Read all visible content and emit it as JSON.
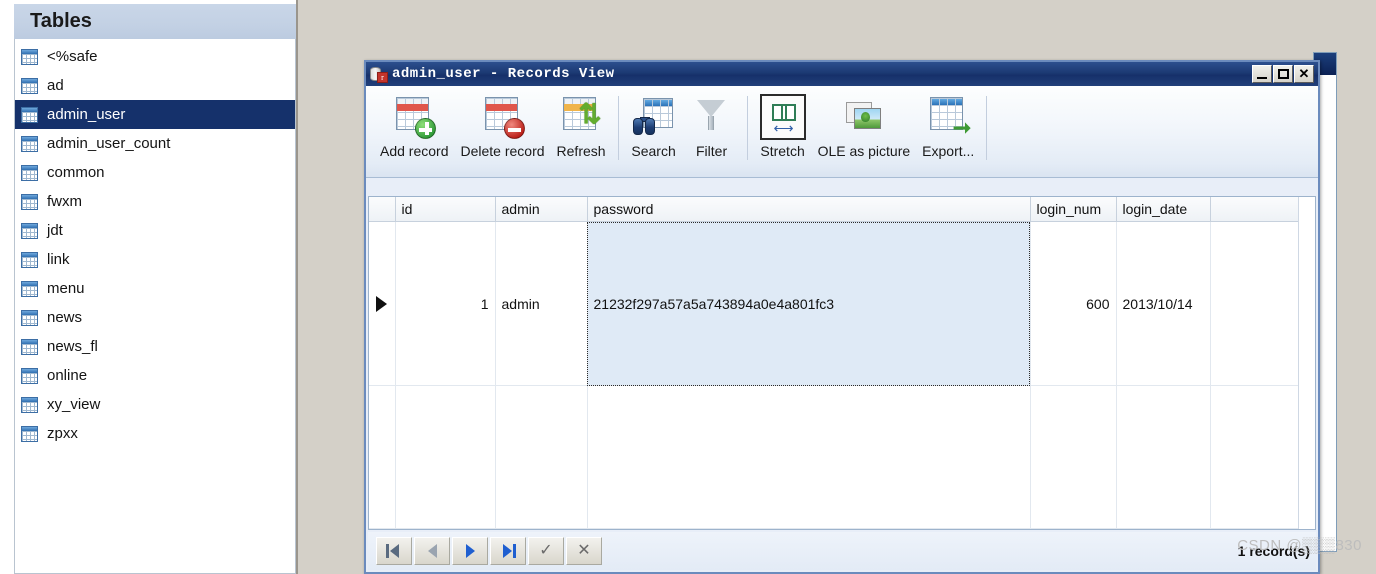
{
  "sidebar": {
    "header_title": "Tables",
    "items": [
      {
        "label": "<%safe",
        "icon": "table-icon",
        "selected": false
      },
      {
        "label": "ad",
        "icon": "table-icon",
        "selected": false
      },
      {
        "label": "admin_user",
        "icon": "table-icon",
        "selected": true
      },
      {
        "label": "admin_user_count",
        "icon": "table-icon",
        "selected": false
      },
      {
        "label": "common",
        "icon": "table-icon",
        "selected": false
      },
      {
        "label": "fwxm",
        "icon": "table-icon",
        "selected": false
      },
      {
        "label": "jdt",
        "icon": "table-icon",
        "selected": false
      },
      {
        "label": "link",
        "icon": "table-icon",
        "selected": false
      },
      {
        "label": "menu",
        "icon": "table-icon",
        "selected": false
      },
      {
        "label": "news",
        "icon": "table-icon",
        "selected": false
      },
      {
        "label": "news_fl",
        "icon": "table-icon",
        "selected": false
      },
      {
        "label": "online",
        "icon": "table-icon",
        "selected": false
      },
      {
        "label": "xy_view",
        "icon": "table-icon",
        "selected": false
      },
      {
        "label": "zpxx",
        "icon": "table-icon",
        "selected": false
      }
    ]
  },
  "window": {
    "title": "admin_user - Records View",
    "title_icon": "database-record-icon",
    "controls": {
      "minimize": "minimize-icon",
      "maximize": "maximize-icon",
      "close": "close-icon"
    }
  },
  "toolbar": {
    "buttons": [
      {
        "label": "Add record",
        "icon": "table-add-icon",
        "pressed": false
      },
      {
        "label": "Delete record",
        "icon": "table-delete-icon",
        "pressed": false
      },
      {
        "label": "Refresh",
        "icon": "table-refresh-icon",
        "pressed": false
      },
      {
        "label": "Search",
        "icon": "binoculars-icon",
        "pressed": false
      },
      {
        "label": "Filter",
        "icon": "funnel-icon",
        "pressed": false
      },
      {
        "label": "Stretch",
        "icon": "stretch-icon",
        "pressed": true
      },
      {
        "label": "OLE as picture",
        "icon": "picture-icon",
        "pressed": false
      },
      {
        "label": "Export...",
        "icon": "table-export-icon",
        "pressed": false
      }
    ]
  },
  "grid": {
    "columns": [
      "",
      "id",
      "admin",
      "password",
      "login_num",
      "login_date"
    ],
    "rows": [
      {
        "marker": "current-row-arrow",
        "id": "1",
        "admin": "admin",
        "password": "21232f297a57a5a743894a0e4a801fc3",
        "login_num": "600",
        "login_date": "2013/10/14",
        "selected_cell": "password"
      }
    ]
  },
  "navbar": {
    "buttons": [
      {
        "name": "first-record-button",
        "icon": "first-icon"
      },
      {
        "name": "previous-record-button",
        "icon": "previous-icon"
      },
      {
        "name": "next-record-button",
        "icon": "next-icon"
      },
      {
        "name": "last-record-button",
        "icon": "last-icon"
      },
      {
        "name": "post-edit-button",
        "icon": "check-icon"
      },
      {
        "name": "cancel-edit-button",
        "icon": "x-icon"
      }
    ],
    "status": "1 record(s)"
  },
  "watermark": {
    "text": "CSDN @▒▒▒830"
  },
  "colors": {
    "sidebar_header_bg": "#c3d1e4",
    "selected_row_bg": "#15316b",
    "titlebar_bg": "#1c3a73",
    "mdi_bg": "#d4d0c8",
    "selected_cell_bg": "#dfeaf6",
    "accent_blue": "#1f5fd0",
    "add_badge_green": "#2f9a38",
    "delete_badge_red": "#bb2019"
  }
}
